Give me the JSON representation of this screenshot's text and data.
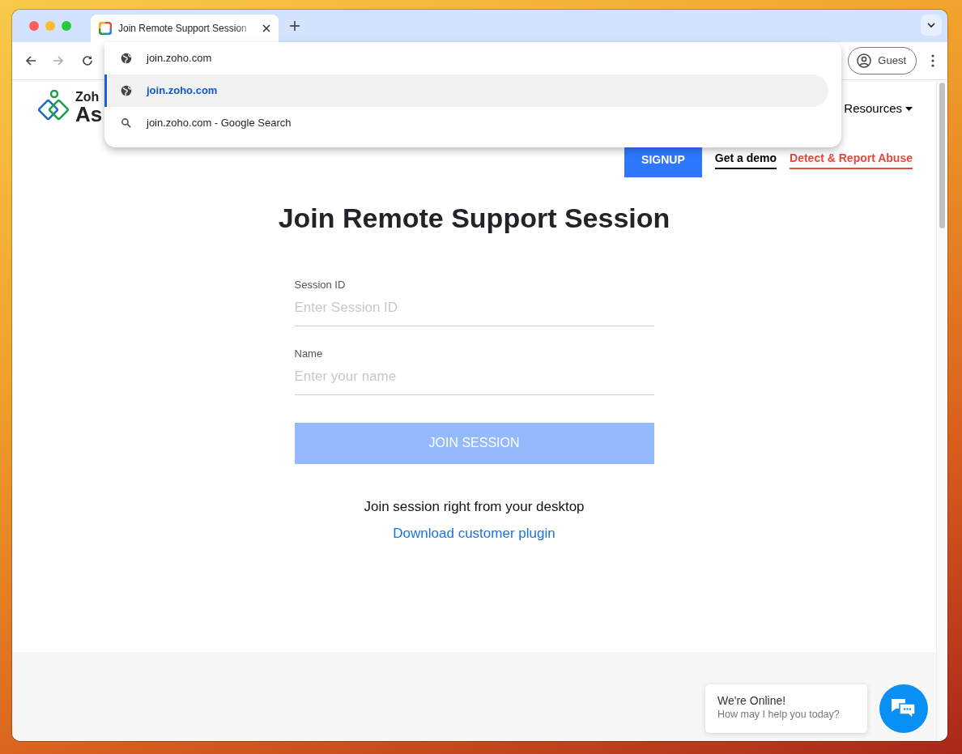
{
  "browser": {
    "tab": {
      "title": "Join Remote Support Session",
      "selected": true
    },
    "omnibox_suggestions": [
      {
        "kind": "url",
        "text": "join.zoho.com",
        "selected": false
      },
      {
        "kind": "url",
        "text": "join.zoho.com",
        "selected": true
      },
      {
        "kind": "search",
        "text": "join.zoho.com",
        "suffix": "- Google Search",
        "selected": false
      }
    ],
    "profile": "Guest"
  },
  "page": {
    "logo": {
      "line1": "Zoh",
      "line2": "As"
    },
    "nav": [
      {
        "label": "Resources"
      }
    ],
    "actions": [
      {
        "kind": "primary",
        "label": "SIGNUP"
      },
      {
        "kind": "link",
        "label": "Get a demo",
        "color": "#000000"
      },
      {
        "kind": "link",
        "label": "Detect & Report Abuse",
        "color": "#e8483c"
      }
    ],
    "title": "Join Remote Support Session",
    "fields": [
      {
        "label": "Session ID",
        "placeholder": "Enter Session ID"
      },
      {
        "label": "Name",
        "placeholder": "Enter your name"
      }
    ],
    "submit": {
      "label": "JOIN SESSION",
      "disabled": true
    },
    "desktop_note": "Join session right from your desktop",
    "plugin_link": "Download customer plugin"
  },
  "chat": {
    "title": "We're Online!",
    "subtitle": "How may I help you today?"
  }
}
